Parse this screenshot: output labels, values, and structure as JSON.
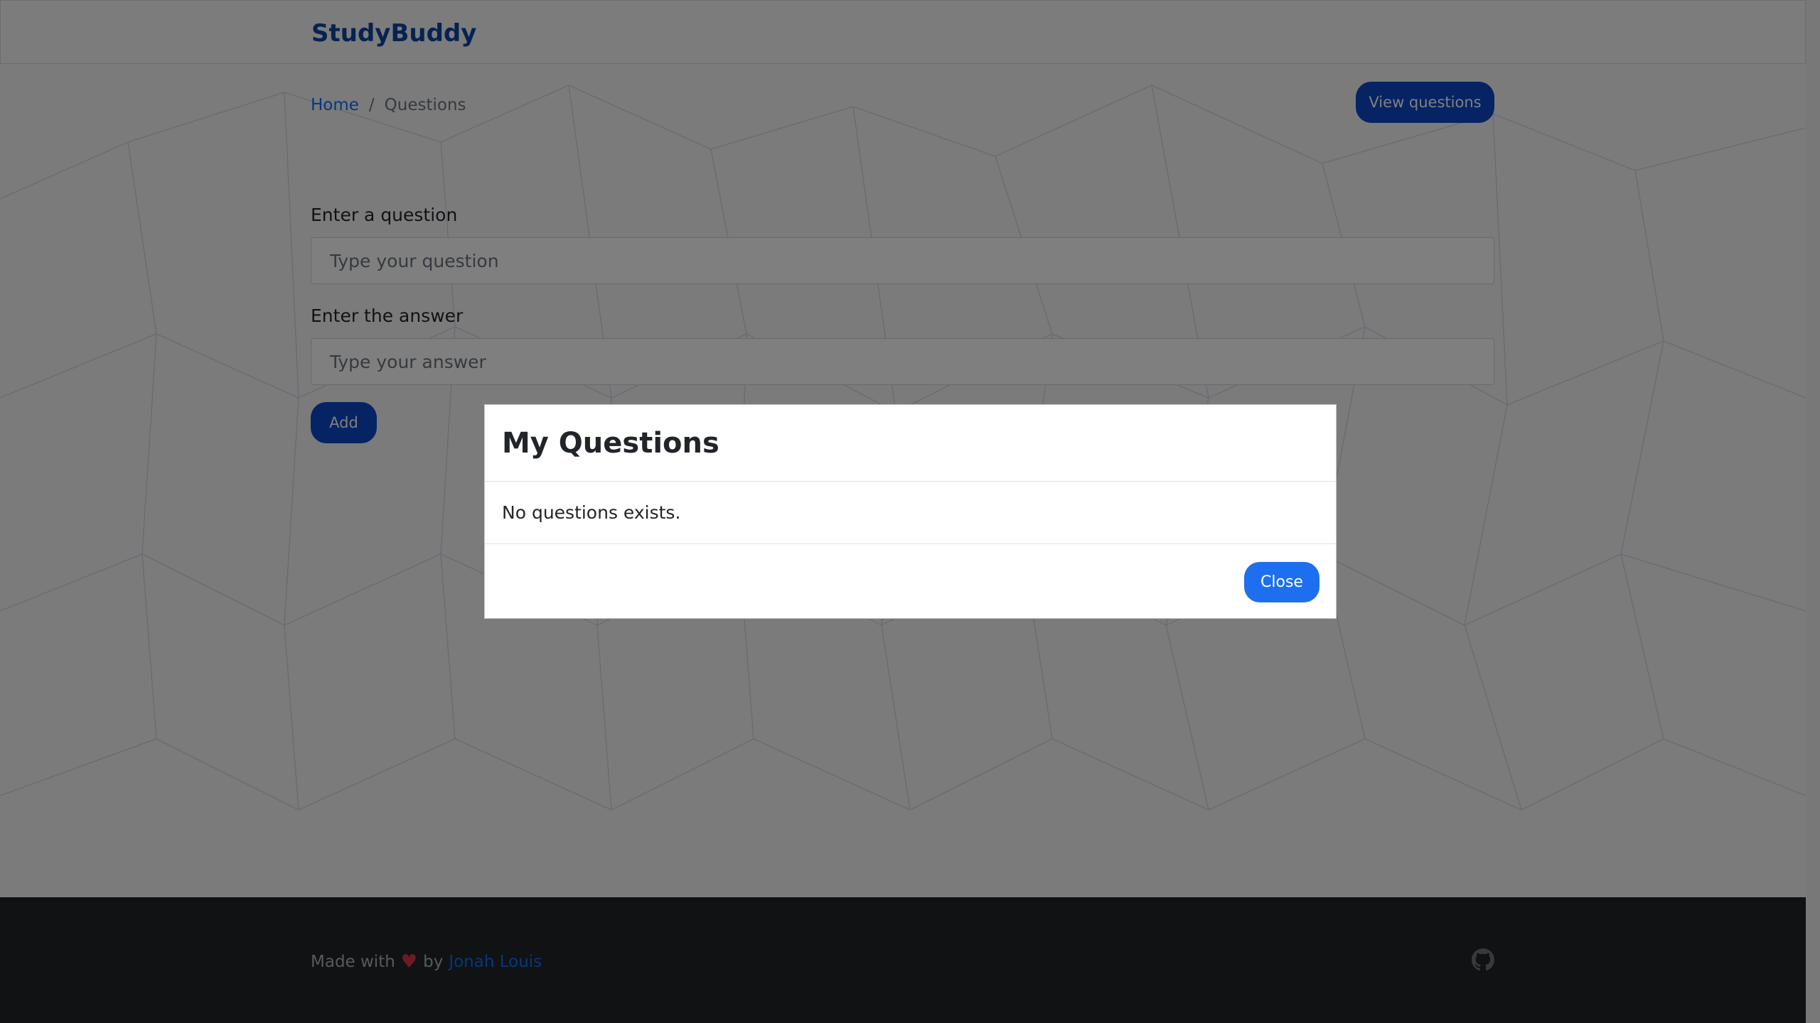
{
  "navbar": {
    "brand": "StudyBuddy"
  },
  "breadcrumb": {
    "home": "Home",
    "separator": "/",
    "current": "Questions"
  },
  "actions": {
    "view_questions": "View questions",
    "add": "Add"
  },
  "form": {
    "question_label": "Enter a question",
    "question_placeholder": "Type your question",
    "answer_label": "Enter the answer",
    "answer_placeholder": "Type your answer"
  },
  "modal": {
    "title": "My Questions",
    "body": "No questions exists.",
    "close": "Close"
  },
  "footer": {
    "made_with": "Made with",
    "heart_icon": "heart-icon",
    "by": "by",
    "author": "Jonah Louis",
    "github_icon": "github-icon"
  },
  "colors": {
    "brand": "#0d47a1",
    "primary_button": "#0d47c8",
    "close_button": "#1e6fef",
    "footer_bg": "#212529",
    "heart": "#dc3545"
  }
}
